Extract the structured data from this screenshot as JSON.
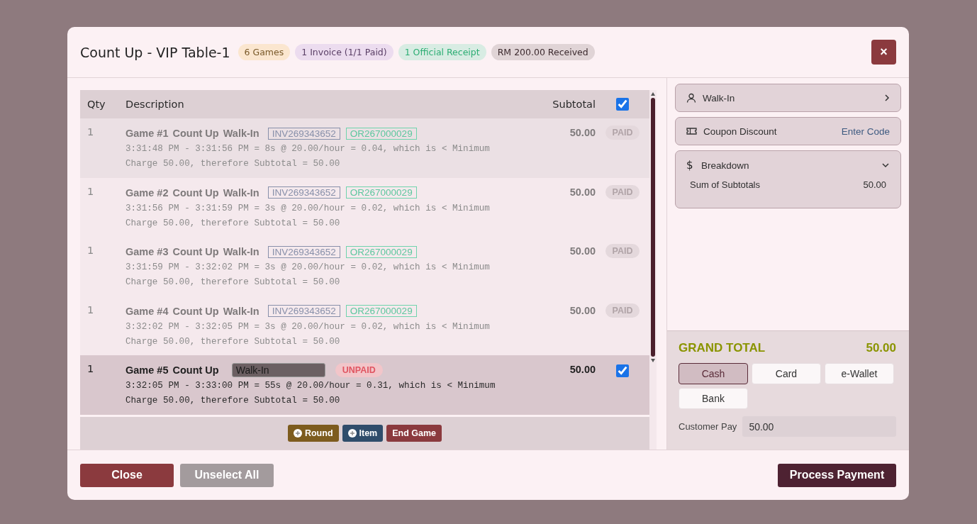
{
  "modal": {
    "title": "Count Up - VIP Table-1",
    "badges": [
      {
        "label": "6 Games",
        "kind": "games"
      },
      {
        "label": "1 Invoice (1/1 Paid)",
        "kind": "invoice"
      },
      {
        "label": "1 Official Receipt",
        "kind": "receipt"
      },
      {
        "label": "RM 200.00 Received",
        "kind": "received"
      }
    ],
    "close_icon": "×"
  },
  "table": {
    "columns": [
      "Qty",
      "Description",
      "Subtotal"
    ],
    "select_all_checked": true,
    "rows": [
      {
        "qty": "1",
        "game": "Game #1",
        "mode": "Count Up",
        "customer": "Walk-In",
        "invoice": "INV269343652",
        "receipt": "OR267000029",
        "detail": "3:31:48 PM - 3:31:56 PM = 8s @ 20.00/hour = 0.04, which is < Minimum Charge 50.00, therefore Subtotal = 50.00",
        "subtotal": "50.00",
        "status": "PAID",
        "kind": "paid",
        "selected": false
      },
      {
        "qty": "1",
        "game": "Game #2",
        "mode": "Count Up",
        "customer": "Walk-In",
        "invoice": "INV269343652",
        "receipt": "OR267000029",
        "detail": "3:31:56 PM - 3:31:59 PM = 3s @ 20.00/hour = 0.02, which is < Minimum Charge 50.00, therefore Subtotal = 50.00",
        "subtotal": "50.00",
        "status": "PAID",
        "kind": "paid",
        "selected": false
      },
      {
        "qty": "1",
        "game": "Game #3",
        "mode": "Count Up",
        "customer": "Walk-In",
        "invoice": "INV269343652",
        "receipt": "OR267000029",
        "detail": "3:31:59 PM - 3:32:02 PM = 3s @ 20.00/hour = 0.02, which is < Minimum Charge 50.00, therefore Subtotal = 50.00",
        "subtotal": "50.00",
        "status": "PAID",
        "kind": "paid",
        "selected": false
      },
      {
        "qty": "1",
        "game": "Game #4",
        "mode": "Count Up",
        "customer": "Walk-In",
        "invoice": "INV269343652",
        "receipt": "OR267000029",
        "detail": "3:32:02 PM - 3:32:05 PM = 3s @ 20.00/hour = 0.02, which is < Minimum Charge 50.00, therefore Subtotal = 50.00",
        "subtotal": "50.00",
        "status": "PAID",
        "kind": "paid",
        "selected": false
      },
      {
        "qty": "1",
        "game": "Game #5",
        "mode": "Count Up",
        "customer": "Walk-In",
        "detail": "3:32:05 PM - 3:33:00 PM = 55s @ 20.00/hour = 0.31, which is < Minimum Charge 50.00, therefore Subtotal = 50.00",
        "subtotal": "50.00",
        "payment_tag": "UNPAID",
        "kind": "unpaid",
        "selected": true,
        "checked": true
      }
    ],
    "actions": [
      {
        "label": "Round",
        "kind": "round"
      },
      {
        "label": "Item",
        "kind": "item"
      },
      {
        "label": "End Game",
        "kind": "end"
      }
    ]
  },
  "sidebar": {
    "customer": "Walk-In",
    "coupon": {
      "label": "Coupon Discount",
      "action": "Enter Code"
    },
    "breakdown": {
      "icon": "$",
      "title": "Breakdown",
      "expanded": true,
      "lines": [
        {
          "label": "Sum of Subtotals",
          "value": "50.00"
        }
      ]
    },
    "grand_total": {
      "label": "GRAND TOTAL",
      "value": "50.00"
    },
    "payment_methods": [
      {
        "label": "Cash",
        "selected": true
      },
      {
        "label": "Card",
        "selected": false
      },
      {
        "label": "e-Wallet",
        "selected": false
      },
      {
        "label": "Bank",
        "selected": false
      }
    ],
    "customer_pay": {
      "label": "Customer Pay",
      "value": "50.00"
    }
  },
  "footer": {
    "buttons": [
      {
        "label": "Close",
        "kind": "close",
        "disabled": false
      },
      {
        "label": "Unselect All",
        "kind": "unselect",
        "disabled": true
      },
      {
        "label": "Process Payment",
        "kind": "process",
        "disabled": false
      }
    ]
  }
}
